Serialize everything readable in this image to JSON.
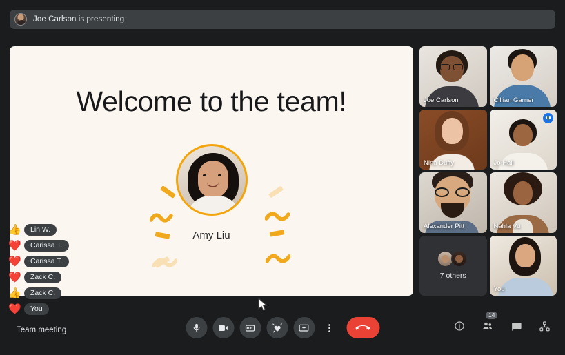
{
  "banner": {
    "text": "Joe Carlson is presenting",
    "avatar_icon": "presenter-avatar"
  },
  "slide": {
    "title": "Welcome to the team!",
    "person_name": "Amy Liu",
    "background_color": "#fbf6f0",
    "accent_color": "#f2a50c"
  },
  "reactions": [
    {
      "emoji": "❤️",
      "name": "You"
    },
    {
      "emoji": "👍",
      "name": "Zack C."
    },
    {
      "emoji": "❤️",
      "name": "Zack C."
    },
    {
      "emoji": "❤️",
      "name": "Carissa T."
    },
    {
      "emoji": "❤️",
      "name": "Carissa T."
    },
    {
      "emoji": "👍",
      "name": "Lin W."
    }
  ],
  "participants": [
    {
      "name": "Joe Carlson",
      "speaking": false,
      "mic_badge": false
    },
    {
      "name": "Cillian Garner",
      "speaking": false,
      "mic_badge": false
    },
    {
      "name": "Nina Duffy",
      "speaking": false,
      "mic_badge": false
    },
    {
      "name": "Jo Hall",
      "speaking": true,
      "mic_badge": true
    },
    {
      "name": "Alexander Pitt",
      "speaking": false,
      "mic_badge": false
    },
    {
      "name": "Nahla Vu",
      "speaking": false,
      "mic_badge": false
    },
    {
      "name": "You",
      "speaking": false,
      "mic_badge": false
    }
  ],
  "others_tile": {
    "label": "7 others"
  },
  "bottom_bar": {
    "meeting_name": "Team meeting",
    "controls": [
      {
        "icon": "microphone-icon",
        "label": "Microphone"
      },
      {
        "icon": "camera-icon",
        "label": "Camera"
      },
      {
        "icon": "captions-icon",
        "label": "Captions"
      },
      {
        "icon": "reactions-icon",
        "label": "Reactions"
      },
      {
        "icon": "present-screen-icon",
        "label": "Present now"
      },
      {
        "icon": "more-options-icon",
        "label": "More options"
      }
    ],
    "hangup": {
      "icon": "hangup-icon",
      "label": "Leave call",
      "color": "#ea4335"
    },
    "right_controls": [
      {
        "icon": "meeting-info-icon",
        "label": "Meeting details",
        "badge": ""
      },
      {
        "icon": "people-icon",
        "label": "People",
        "badge": "14"
      },
      {
        "icon": "chat-icon",
        "label": "Chat",
        "badge": ""
      },
      {
        "icon": "activities-icon",
        "label": "Activities",
        "badge": ""
      }
    ]
  }
}
